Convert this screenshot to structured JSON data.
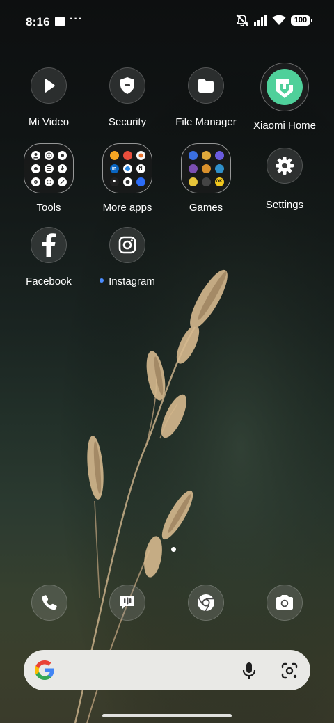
{
  "status_bar": {
    "time": "8:16",
    "dots": "···",
    "battery": "100",
    "icons": [
      "notifications-off-icon",
      "signal-icon",
      "wifi-icon",
      "battery-icon"
    ]
  },
  "apps": {
    "mi_video": {
      "label": "Mi Video",
      "icon": "play-icon"
    },
    "security": {
      "label": "Security",
      "icon": "shield-icon"
    },
    "file_manager": {
      "label": "File Manager",
      "icon": "folder-icon"
    },
    "xiaomi_home": {
      "label": "Xiaomi Home",
      "icon": "xiaomi-home-icon",
      "color": "#4fd09a"
    },
    "tools": {
      "label": "Tools",
      "icon": "folder-tools-icon"
    },
    "more_apps": {
      "label": "More apps",
      "icon": "folder-more-apps-icon"
    },
    "games": {
      "label": "Games",
      "icon": "folder-games-icon"
    },
    "settings": {
      "label": "Settings",
      "icon": "gear-icon"
    },
    "facebook": {
      "label": "Facebook",
      "icon": "facebook-icon"
    },
    "instagram": {
      "label": "Instagram",
      "icon": "instagram-icon",
      "new_indicator_color": "#4a8cff"
    }
  },
  "folders": {
    "more_apps_letters": [
      "N",
      "M"
    ],
    "games_letters": [
      "OK"
    ]
  },
  "dock": [
    "phone-icon",
    "messages-icon",
    "chrome-icon",
    "camera-icon"
  ],
  "search": {
    "icons": [
      "google-g-icon",
      "microphone-icon",
      "google-lens-icon"
    ]
  }
}
